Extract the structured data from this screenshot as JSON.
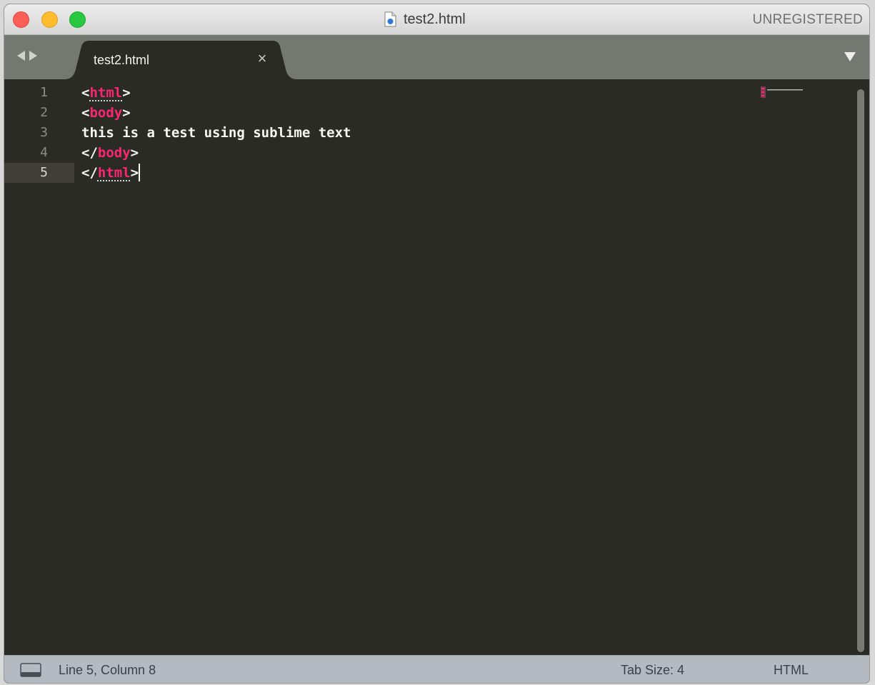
{
  "window": {
    "title": "test2.html",
    "registration": "UNREGISTERED"
  },
  "tabs": [
    {
      "label": "test2.html",
      "active": true
    }
  ],
  "editor": {
    "line_numbers": [
      "1",
      "2",
      "3",
      "4",
      "5"
    ],
    "active_line": "5",
    "lines": [
      {
        "open": "<",
        "tag": "html",
        "close": ">"
      },
      {
        "open": "<",
        "tag": "body",
        "close": ">"
      },
      {
        "text": "this is a test using sublime text"
      },
      {
        "open": "</",
        "tag": "body",
        "close": ">"
      },
      {
        "open": "</",
        "tag": "html",
        "close": ">"
      }
    ]
  },
  "statusbar": {
    "position": "Line 5, Column 8",
    "tab_size": "Tab Size: 4",
    "syntax": "HTML"
  },
  "colors": {
    "editor_bg": "#2b2b26",
    "tag": "#f92672",
    "text": "#f8f8f2",
    "tabbar_bg": "#737870",
    "statusbar_bg": "#b4b9c2"
  },
  "icons": [
    "close-window-icon",
    "minimize-window-icon",
    "maximize-window-icon",
    "html-file-icon",
    "back-arrow-icon",
    "forward-arrow-icon",
    "close-tab-icon",
    "tab-menu-icon",
    "panel-toggle-icon"
  ]
}
